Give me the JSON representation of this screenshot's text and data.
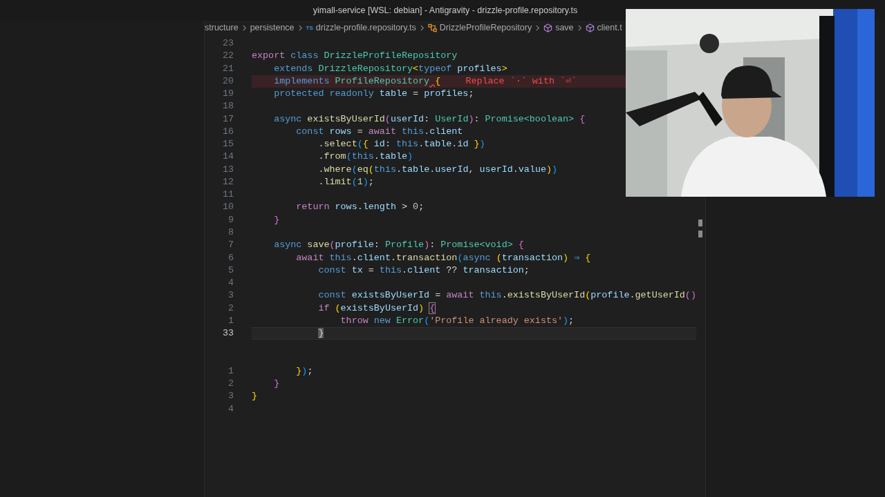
{
  "window": {
    "title": "yimall-service [WSL: debian] - Antigravity - drizzle-profile.repository.ts"
  },
  "breadcrumbs": [
    {
      "text": "structure",
      "kind": "folder"
    },
    {
      "text": "persistence",
      "kind": "folder"
    },
    {
      "text": "drizzle-profile.repository.ts",
      "kind": "file",
      "icon": "TS"
    },
    {
      "text": "DrizzleProfileRepository",
      "kind": "class"
    },
    {
      "text": "save",
      "kind": "method"
    },
    {
      "text": "client.t",
      "kind": "method"
    }
  ],
  "editor": {
    "lines": [
      {
        "number": "23",
        "current": false,
        "error": false
      },
      {
        "number": "22",
        "current": false,
        "error": false,
        "tokens": [
          {
            "text": "export ",
            "kind": "kw"
          },
          {
            "text": "class ",
            "kind": "st"
          },
          {
            "text": "DrizzleProfileRepository",
            "kind": "type"
          }
        ]
      },
      {
        "number": "21",
        "current": false,
        "error": false,
        "tokens": [
          {
            "text": "    extends ",
            "kind": "st"
          },
          {
            "text": "DrizzleRepository",
            "kind": "type"
          },
          {
            "text": "<",
            "kind": "br1"
          },
          {
            "text": "typeof ",
            "kind": "st"
          },
          {
            "text": "profiles",
            "kind": "var"
          },
          {
            "text": ">",
            "kind": "br1"
          }
        ]
      },
      {
        "number": "20",
        "current": false,
        "error": true,
        "hint": "Replace `·` with `⏎`",
        "tokens": [
          {
            "text": "    implements ",
            "kind": "st"
          },
          {
            "text": "ProfileRepository",
            "kind": "type"
          },
          {
            "text": " {",
            "kind": "squiggle"
          }
        ]
      },
      {
        "number": "19",
        "current": false,
        "error": false,
        "tokens": [
          {
            "text": "    protected readonly ",
            "kind": "st"
          },
          {
            "text": "table",
            "kind": "var"
          },
          {
            "text": " = ",
            "kind": "punc"
          },
          {
            "text": "profiles",
            "kind": "var"
          },
          {
            "text": ";",
            "kind": "punc"
          }
        ]
      },
      {
        "number": "18",
        "current": false,
        "error": false
      },
      {
        "number": "17",
        "current": false,
        "error": false,
        "tokens": [
          {
            "text": "    async ",
            "kind": "st"
          },
          {
            "text": "existsByUserId",
            "kind": "fn"
          },
          {
            "text": "(",
            "kind": "br2"
          },
          {
            "text": "userId",
            "kind": "var"
          },
          {
            "text": ": ",
            "kind": "punc"
          },
          {
            "text": "UserId",
            "kind": "type"
          },
          {
            "text": ")",
            "kind": "br2"
          },
          {
            "text": ": ",
            "kind": "punc"
          },
          {
            "text": "Promise<boolean> ",
            "kind": "type"
          },
          {
            "text": "{",
            "kind": "br2"
          }
        ]
      },
      {
        "number": "16",
        "current": false,
        "error": false,
        "tokens": [
          {
            "text": "        const ",
            "kind": "st"
          },
          {
            "text": "rows",
            "kind": "var"
          },
          {
            "text": " = ",
            "kind": "punc"
          },
          {
            "text": "await ",
            "kind": "kw"
          },
          {
            "text": "this",
            "kind": "st"
          },
          {
            "text": ".",
            "kind": "punc"
          },
          {
            "text": "client",
            "kind": "var"
          }
        ]
      },
      {
        "number": "15",
        "current": false,
        "error": false,
        "tokens": [
          {
            "text": "            .",
            "kind": "punc"
          },
          {
            "text": "select",
            "kind": "fn"
          },
          {
            "text": "(",
            "kind": "br3"
          },
          {
            "text": "{ ",
            "kind": "br1"
          },
          {
            "text": "id",
            "kind": "var"
          },
          {
            "text": ": ",
            "kind": "punc"
          },
          {
            "text": "this",
            "kind": "st"
          },
          {
            "text": ".",
            "kind": "punc"
          },
          {
            "text": "table",
            "kind": "var"
          },
          {
            "text": ".",
            "kind": "punc"
          },
          {
            "text": "id",
            "kind": "var"
          },
          {
            "text": " }",
            "kind": "br1"
          },
          {
            "text": ")",
            "kind": "br3"
          }
        ]
      },
      {
        "number": "14",
        "current": false,
        "error": false,
        "tokens": [
          {
            "text": "            .",
            "kind": "punc"
          },
          {
            "text": "from",
            "kind": "fn"
          },
          {
            "text": "(",
            "kind": "br3"
          },
          {
            "text": "this",
            "kind": "st"
          },
          {
            "text": ".",
            "kind": "punc"
          },
          {
            "text": "table",
            "kind": "var"
          },
          {
            "text": ")",
            "kind": "br3"
          }
        ]
      },
      {
        "number": "13",
        "current": false,
        "error": false,
        "tokens": [
          {
            "text": "            .",
            "kind": "punc"
          },
          {
            "text": "where",
            "kind": "fn"
          },
          {
            "text": "(",
            "kind": "br3"
          },
          {
            "text": "eq",
            "kind": "fn"
          },
          {
            "text": "(",
            "kind": "br1"
          },
          {
            "text": "this",
            "kind": "st"
          },
          {
            "text": ".",
            "kind": "punc"
          },
          {
            "text": "table",
            "kind": "var"
          },
          {
            "text": ".",
            "kind": "punc"
          },
          {
            "text": "userId",
            "kind": "var"
          },
          {
            "text": ", ",
            "kind": "punc"
          },
          {
            "text": "userId",
            "kind": "var"
          },
          {
            "text": ".",
            "kind": "punc"
          },
          {
            "text": "value",
            "kind": "var"
          },
          {
            "text": ")",
            "kind": "br1"
          },
          {
            "text": ")",
            "kind": "br3"
          }
        ]
      },
      {
        "number": "12",
        "current": false,
        "error": false,
        "tokens": [
          {
            "text": "            .",
            "kind": "punc"
          },
          {
            "text": "limit",
            "kind": "fn"
          },
          {
            "text": "(",
            "kind": "br3"
          },
          {
            "text": "1",
            "kind": "num"
          },
          {
            "text": ")",
            "kind": "br3"
          },
          {
            "text": ";",
            "kind": "punc"
          }
        ]
      },
      {
        "number": "11",
        "current": false,
        "error": false
      },
      {
        "number": "10",
        "current": false,
        "error": false,
        "tokens": [
          {
            "text": "        return ",
            "kind": "kw"
          },
          {
            "text": "rows",
            "kind": "var"
          },
          {
            "text": ".",
            "kind": "punc"
          },
          {
            "text": "length",
            "kind": "var"
          },
          {
            "text": " > ",
            "kind": "punc"
          },
          {
            "text": "0",
            "kind": "num"
          },
          {
            "text": ";",
            "kind": "punc"
          }
        ]
      },
      {
        "number": "9",
        "current": false,
        "error": false,
        "tokens": [
          {
            "text": "    }",
            "kind": "br2"
          }
        ]
      },
      {
        "number": "8",
        "current": false,
        "error": false
      },
      {
        "number": "7",
        "current": false,
        "error": false,
        "tokens": [
          {
            "text": "    async ",
            "kind": "st"
          },
          {
            "text": "save",
            "kind": "fn"
          },
          {
            "text": "(",
            "kind": "br2"
          },
          {
            "text": "profile",
            "kind": "var"
          },
          {
            "text": ": ",
            "kind": "punc"
          },
          {
            "text": "Profile",
            "kind": "type"
          },
          {
            "text": ")",
            "kind": "br2"
          },
          {
            "text": ": ",
            "kind": "punc"
          },
          {
            "text": "Promise<void> ",
            "kind": "type"
          },
          {
            "text": "{",
            "kind": "br2"
          }
        ]
      },
      {
        "number": "6",
        "current": false,
        "error": false,
        "tokens": [
          {
            "text": "        await ",
            "kind": "kw"
          },
          {
            "text": "this",
            "kind": "st"
          },
          {
            "text": ".",
            "kind": "punc"
          },
          {
            "text": "client",
            "kind": "var"
          },
          {
            "text": ".",
            "kind": "punc"
          },
          {
            "text": "transaction",
            "kind": "fn"
          },
          {
            "text": "(",
            "kind": "br3"
          },
          {
            "text": "async ",
            "kind": "st"
          },
          {
            "text": "(",
            "kind": "br1"
          },
          {
            "text": "transaction",
            "kind": "var"
          },
          {
            "text": ")",
            "kind": "br1"
          },
          {
            "text": " ⇒ ",
            "kind": "st"
          },
          {
            "text": "{",
            "kind": "br1"
          }
        ]
      },
      {
        "number": "5",
        "current": false,
        "error": false,
        "tokens": [
          {
            "text": "            const ",
            "kind": "st"
          },
          {
            "text": "tx",
            "kind": "var"
          },
          {
            "text": " = ",
            "kind": "punc"
          },
          {
            "text": "this",
            "kind": "st"
          },
          {
            "text": ".",
            "kind": "punc"
          },
          {
            "text": "client",
            "kind": "var"
          },
          {
            "text": " ?? ",
            "kind": "punc"
          },
          {
            "text": "transaction",
            "kind": "var"
          },
          {
            "text": ";",
            "kind": "punc"
          }
        ]
      },
      {
        "number": "4",
        "current": false,
        "error": false
      },
      {
        "number": "3",
        "current": false,
        "error": false,
        "tokens": [
          {
            "text": "            const ",
            "kind": "st"
          },
          {
            "text": "existsByUserId",
            "kind": "var"
          },
          {
            "text": " = ",
            "kind": "punc"
          },
          {
            "text": "await ",
            "kind": "kw"
          },
          {
            "text": "this",
            "kind": "st"
          },
          {
            "text": ".",
            "kind": "punc"
          },
          {
            "text": "existsByUserId",
            "kind": "fn"
          },
          {
            "text": "(",
            "kind": "br1"
          },
          {
            "text": "profile",
            "kind": "var"
          },
          {
            "text": ".",
            "kind": "punc"
          },
          {
            "text": "getUserId",
            "kind": "fn"
          },
          {
            "text": "()",
            "kind": "br2"
          }
        ]
      },
      {
        "number": "2",
        "current": false,
        "error": false,
        "tokens": [
          {
            "text": "            if ",
            "kind": "kw"
          },
          {
            "text": "(",
            "kind": "br1"
          },
          {
            "text": "existsByUserId",
            "kind": "var"
          },
          {
            "text": ")",
            "kind": "br1"
          },
          {
            "text": " {",
            "kind": "match"
          }
        ]
      },
      {
        "number": "1",
        "current": false,
        "error": false,
        "tokens": [
          {
            "text": "                throw ",
            "kind": "kw"
          },
          {
            "text": "new ",
            "kind": "st"
          },
          {
            "text": "Error",
            "kind": "type"
          },
          {
            "text": "(",
            "kind": "br3"
          },
          {
            "text": "'Profile already exists'",
            "kind": "str"
          },
          {
            "text": ")",
            "kind": "br3"
          },
          {
            "text": ";",
            "kind": "punc"
          }
        ]
      },
      {
        "number": "33",
        "current": true,
        "error": false,
        "tokens": [
          {
            "text": "            }",
            "kind": "cursor"
          }
        ]
      },
      {
        "current": false,
        "error": false
      },
      {
        "current": false,
        "error": false
      },
      {
        "number": "1",
        "current": false,
        "error": false,
        "tokens": [
          {
            "text": "        }",
            "kind": "br1"
          },
          {
            "text": ")",
            "kind": "br3"
          },
          {
            "text": ";",
            "kind": "punc"
          }
        ]
      },
      {
        "number": "2",
        "current": false,
        "error": false,
        "tokens": [
          {
            "text": "    }",
            "kind": "br2"
          }
        ]
      },
      {
        "number": "3",
        "current": false,
        "error": false,
        "tokens": [
          {
            "text": "}",
            "kind": "br1"
          }
        ]
      },
      {
        "number": "4",
        "current": false,
        "error": false
      }
    ]
  }
}
